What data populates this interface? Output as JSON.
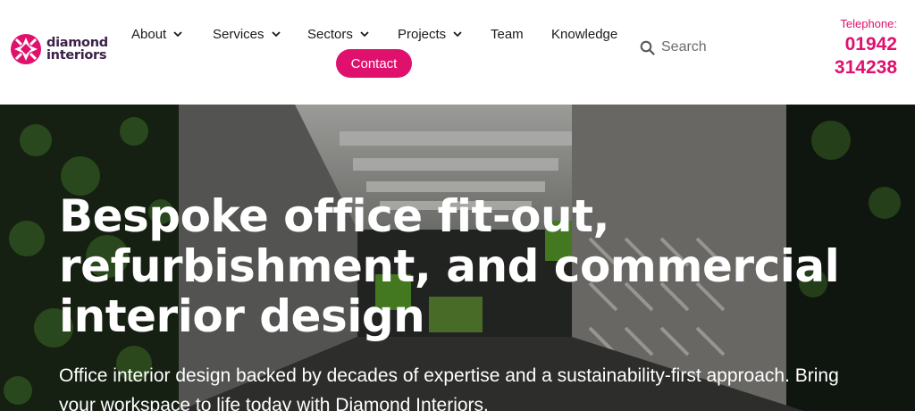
{
  "brand": {
    "line1": "diamond",
    "line2": "interiors",
    "color": "#e0106d",
    "text_color": "#3b2248"
  },
  "nav": {
    "items": [
      {
        "label": "About",
        "dropdown": true
      },
      {
        "label": "Services",
        "dropdown": true
      },
      {
        "label": "Sectors",
        "dropdown": true
      },
      {
        "label": "Projects",
        "dropdown": true
      },
      {
        "label": "Team",
        "dropdown": false
      },
      {
        "label": "Knowledge",
        "dropdown": false
      }
    ],
    "contact_label": "Contact",
    "accent": "#e0106d"
  },
  "search": {
    "placeholder": "Search",
    "icon": "search-icon"
  },
  "phone": {
    "label": "Telephone:",
    "number": "01942 314238"
  },
  "hero": {
    "title": "Bespoke office fit-out, refurbishment, and commercial interior design",
    "subtitle": "Office interior design backed by decades of expertise and a sustainability-first approach. Bring your workspace to life today with Diamond Interiors."
  }
}
